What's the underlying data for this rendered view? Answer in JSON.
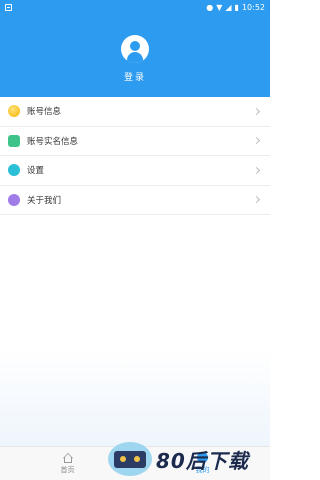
{
  "status_bar": {
    "time": "10:52",
    "indicators": [
      "location-icon",
      "wifi-icon",
      "signal-icon",
      "battery-icon"
    ]
  },
  "header": {
    "login_label": "登录",
    "color": "#2d9bf0"
  },
  "menu": {
    "items": [
      {
        "label": "账号信息",
        "icon": "coin-icon"
      },
      {
        "label": "账号实名信息",
        "icon": "id-card-icon"
      },
      {
        "label": "设置",
        "icon": "settings-icon"
      },
      {
        "label": "关于我们",
        "icon": "smile-icon"
      }
    ]
  },
  "tabbar": {
    "tabs": [
      {
        "label": "首页",
        "icon": "home-icon",
        "active": false
      },
      {
        "label": "我的",
        "icon": "user-icon",
        "active": true
      }
    ]
  },
  "watermark": {
    "text": "80后下载"
  }
}
